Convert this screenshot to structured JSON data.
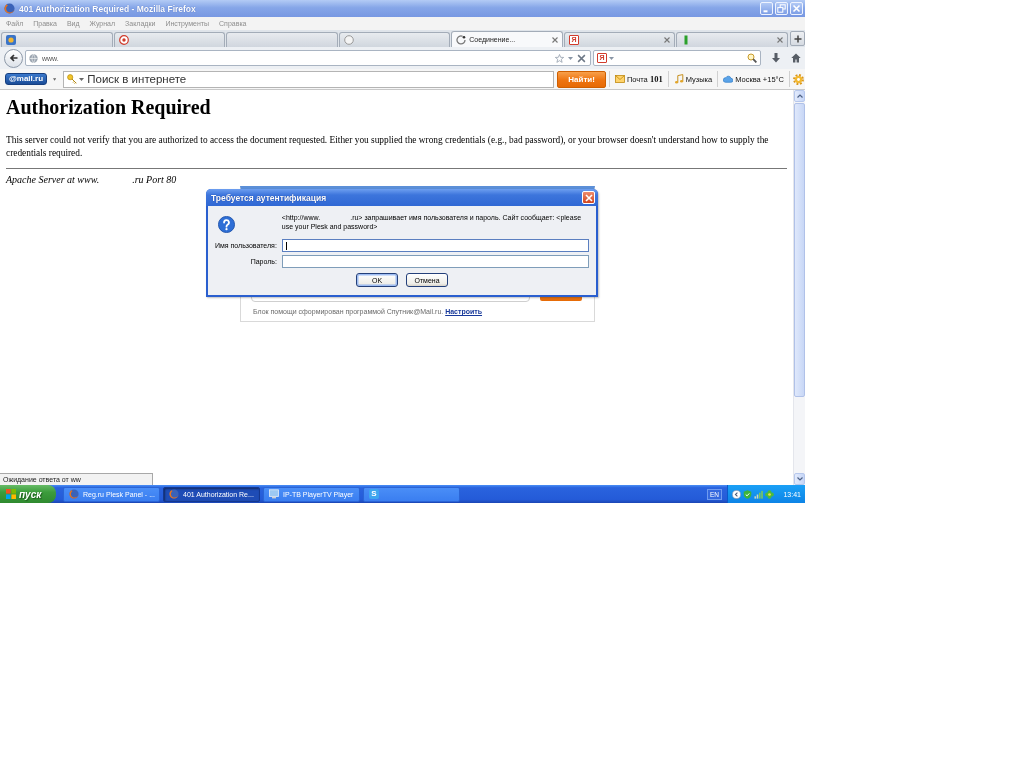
{
  "window": {
    "title": "401 Authorization Required - Mozilla Firefox"
  },
  "menu": [
    "Файл",
    "Правка",
    "Вид",
    "Журнал",
    "Закладки",
    "Инструменты",
    "Справка"
  ],
  "tabs": [
    {
      "kind": "tile",
      "selected": false,
      "closable": false
    },
    {
      "kind": "target",
      "selected": false,
      "closable": false
    },
    {
      "kind": "none",
      "selected": false,
      "closable": false
    },
    {
      "kind": "ring",
      "selected": false,
      "closable": false
    },
    {
      "kind": "spinner",
      "label": "Соединение...",
      "selected": true,
      "closable": true
    },
    {
      "kind": "letter",
      "glyph": "Я",
      "selected": false,
      "closable": true
    },
    {
      "kind": "bar",
      "selected": false,
      "closable": true
    }
  ],
  "navigation": {
    "url": "www.",
    "search_engine_glyph": "Я"
  },
  "mailru_bar": {
    "logo": "@mail.ru",
    "search": {
      "placeholder": "Поиск в интернете"
    },
    "search_button": "Найти!",
    "items": [
      {
        "kind": "mail",
        "label": "Почта **101**"
      },
      {
        "kind": "music",
        "label": "Музыка"
      },
      {
        "kind": "weather",
        "label": "Москва +15°C"
      }
    ]
  },
  "page": {
    "heading": "Authorization Required",
    "text": "This server could not verify that you are authorized to access the document requested. Either you supplied the wrong credentials (e.g., bad password), or your browser doesn't understand how to supply the credentials required.",
    "address_parts": [
      "Apache Server at www.",
      ".ru Port 80"
    ],
    "help_block": {
      "note": "Блок помощи сформирован программой Спутник@Mail.ru.",
      "link": "Настроить"
    }
  },
  "dialog": {
    "title": "Требуется аутентификация",
    "message_parts": [
      "<http://www.",
      ".ru> запрашивает имя пользователя и пароль. Сайт сообщает: <please use your Plesk and password>"
    ],
    "fields": [
      {
        "label": "Имя пользователя:",
        "focused": true
      },
      {
        "label": "Пароль:",
        "focused": false
      }
    ],
    "buttons": [
      {
        "label": "OK",
        "default": true
      },
      {
        "label": "Отмена",
        "default": false
      }
    ]
  },
  "status": "Ожидание ответа от ww",
  "taskbar": {
    "start": "пуск",
    "tasks": [
      {
        "kind": "browser",
        "label": "Reg.ru Plesk Panel - ...",
        "selected": false
      },
      {
        "kind": "browser",
        "label": "401 Authorization Re...",
        "selected": true
      },
      {
        "kind": "monitor",
        "label": "IP-TB PlayerTV Player",
        "selected": false
      },
      {
        "kind": "letter",
        "glyph": "S",
        "selected": false
      }
    ],
    "language": "EN",
    "clock": "13:41"
  }
}
